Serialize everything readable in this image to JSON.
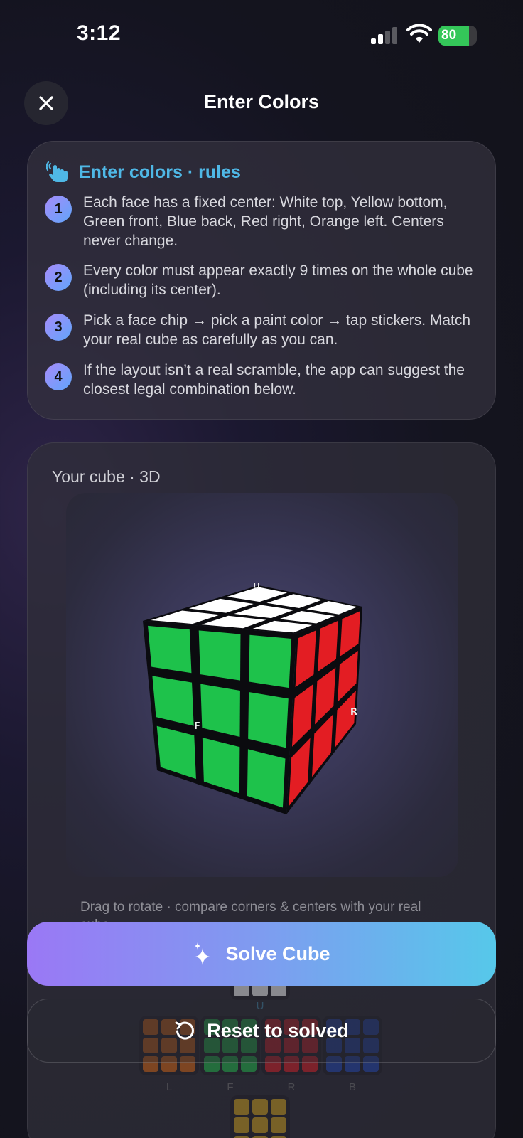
{
  "status_bar": {
    "time": "3:12",
    "battery": "80",
    "battery_level": 0.8
  },
  "header": {
    "title": "Enter Colors",
    "close_icon": "close-icon"
  },
  "rules": {
    "title": "Enter colors · rules",
    "icon": "hand-tap-icon",
    "items": [
      {
        "num": "1",
        "text": "Each face has a fixed center: White top, Yellow bottom, Green front, Blue back, Red right, Orange left. Centers never change."
      },
      {
        "num": "2",
        "text": "Every color must appear exactly 9 times on the whole cube (including its center)."
      },
      {
        "num": "3",
        "text": "Pick a face chip → pick a paint color → tap stickers. Match your real cube as carefully as you can."
      },
      {
        "num": "4",
        "text": "If the layout isn’t a real scramble, the app can suggest the closest legal combination below."
      }
    ]
  },
  "cube": {
    "title": "Your cube · 3D",
    "hint": "Drag to rotate · compare corners & centers with your real cube",
    "face_labels": {
      "top": "U",
      "front": "F",
      "right": "R"
    },
    "net_labels": {
      "up": "U",
      "left": "L",
      "front": "F",
      "right": "R",
      "back": "B"
    },
    "colors": {
      "white": "#ffffff",
      "green": "#1ec24b",
      "red": "#e31d23",
      "blue": "#2146b8",
      "orange": "#e36a10",
      "yellow": "#d9a81a"
    }
  },
  "actions": {
    "solve": "Solve Cube",
    "reset": "Reset to solved",
    "solve_icon": "sparkles-icon",
    "reset_icon": "reset-icon"
  }
}
